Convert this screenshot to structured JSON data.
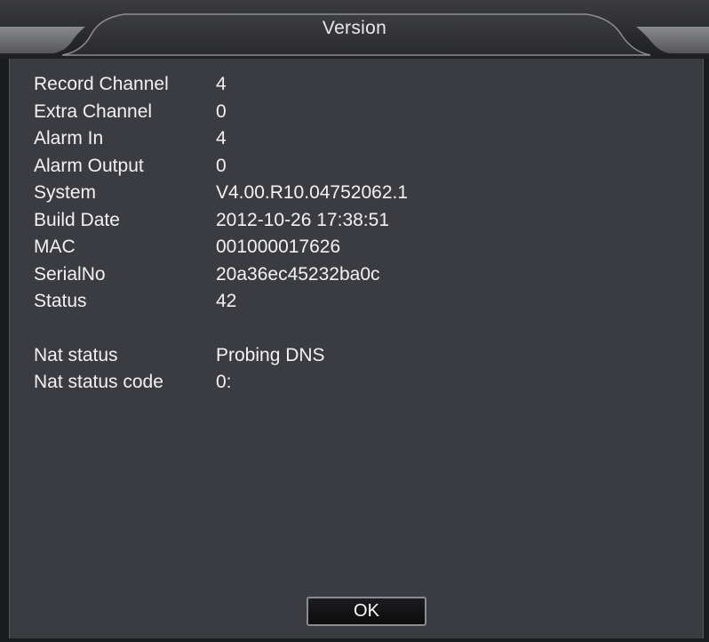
{
  "window": {
    "title": "Version"
  },
  "info": {
    "rows": [
      {
        "label": "Record Channel",
        "value": "4"
      },
      {
        "label": "Extra Channel",
        "value": "0"
      },
      {
        "label": "Alarm In",
        "value": "4"
      },
      {
        "label": "Alarm Output",
        "value": "0"
      },
      {
        "label": "System",
        "value": "V4.00.R10.04752062.1"
      },
      {
        "label": "Build Date",
        "value": "2012-10-26 17:38:51"
      },
      {
        "label": "MAC",
        "value": "001000017626"
      },
      {
        "label": "SerialNo",
        "value": "20a36ec45232ba0c"
      },
      {
        "label": "Status",
        "value": "42"
      }
    ],
    "nat_rows": [
      {
        "label": "Nat status",
        "value": "Probing DNS"
      },
      {
        "label": "Nat status code",
        "value": "0:"
      }
    ]
  },
  "footer": {
    "ok_label": "OK"
  },
  "colors": {
    "panel_background": "#3a3c42",
    "titlebar_background": "#1e1f22",
    "text": "#f2f2f2",
    "button_border": "#8b8c90"
  }
}
